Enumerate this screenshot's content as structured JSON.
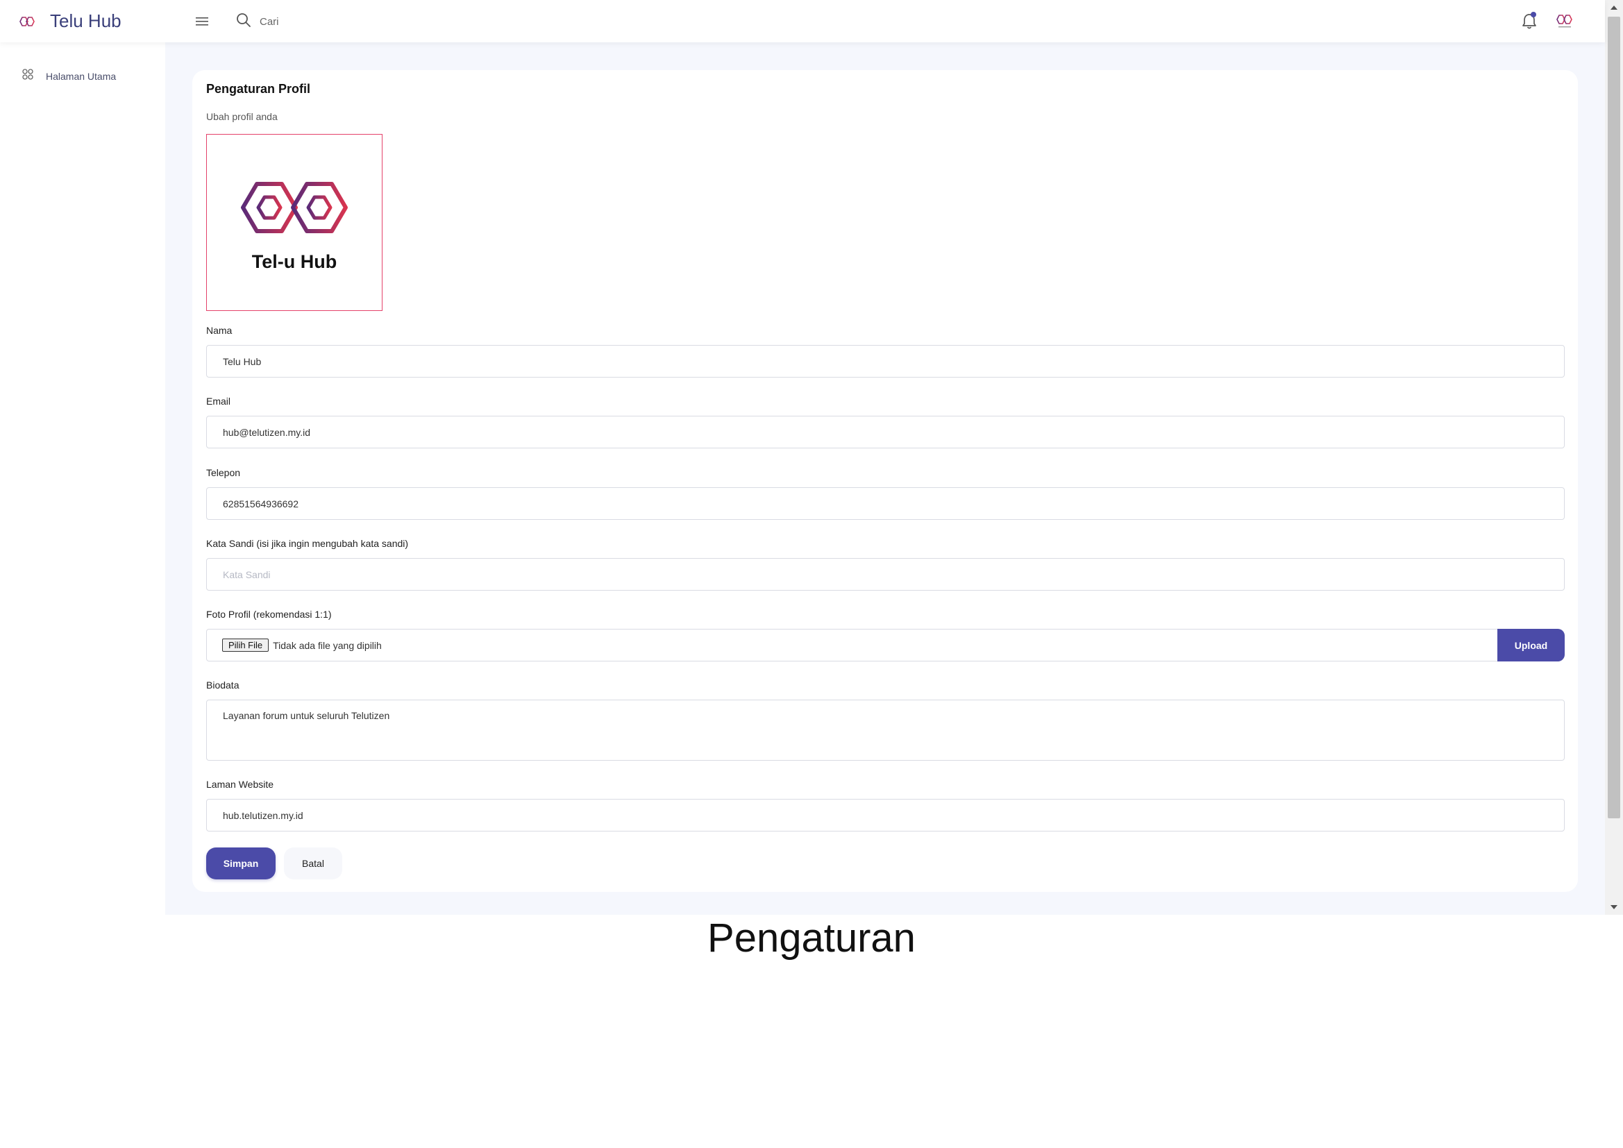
{
  "app": {
    "title": "Telu Hub",
    "accent_color": "#4b4ba8",
    "logo_icon": "telu-hub-logo-icon"
  },
  "header": {
    "search_placeholder": "Cari",
    "menu_icon": "hamburger-menu-icon",
    "search_icon": "search-icon",
    "notification_icon": "bell-icon",
    "avatar_icon": "user-avatar-icon"
  },
  "sidebar": {
    "items": [
      {
        "label": "Halaman Utama",
        "icon": "grid-icon"
      }
    ]
  },
  "profile_form": {
    "title": "Pengaturan Profil",
    "subtitle": "Ubah profil anda",
    "image_caption": "Tel-u Hub",
    "name": {
      "label": "Nama",
      "value": "Telu Hub"
    },
    "email": {
      "label": "Email",
      "value": "hub@telutizen.my.id"
    },
    "phone": {
      "label": "Telepon",
      "value": "62851564936692"
    },
    "password": {
      "label": "Kata Sandi (isi jika ingin mengubah kata sandi)",
      "placeholder": "Kata Sandi",
      "value": ""
    },
    "photo": {
      "label": "Foto Profil (rekomendasi 1:1)",
      "choose_label": "Pilih File",
      "status": "Tidak ada file yang dipilih",
      "upload_label": "Upload"
    },
    "bio": {
      "label": "Biodata",
      "value": "Layanan forum untuk seluruh Telutizen"
    },
    "website": {
      "label": "Laman Website",
      "value": "hub.telutizen.my.id"
    },
    "save_label": "Simpan",
    "cancel_label": "Batal"
  },
  "caption": "Pengaturan"
}
